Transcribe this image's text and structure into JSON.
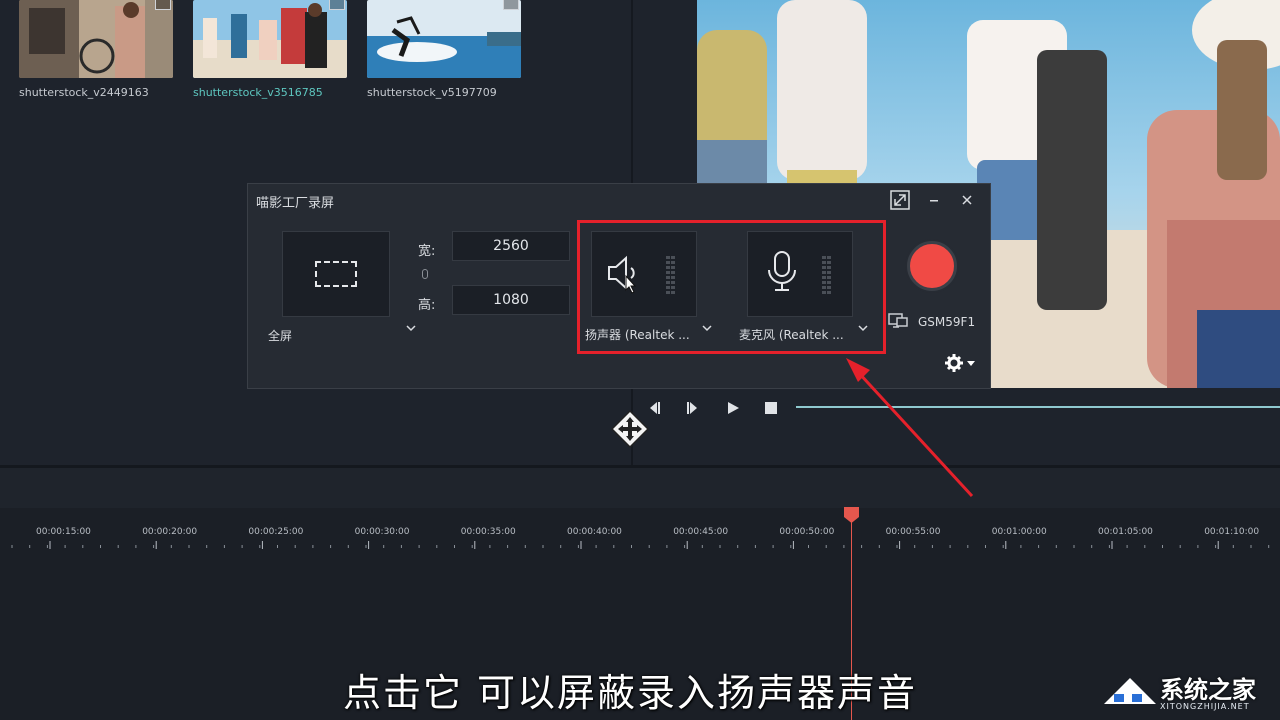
{
  "media": {
    "items": [
      {
        "name": "shutterstock_v2449163",
        "active": false
      },
      {
        "name": "shutterstock_v3516785",
        "active": true
      },
      {
        "name": "shutterstock_v5197709",
        "active": false
      }
    ]
  },
  "recorder": {
    "title": "喵影工厂录屏",
    "mode": "全屏",
    "width_label": "宽:",
    "width_value": "2560",
    "height_label": "高:",
    "height_value": "1080",
    "speaker_label": "扬声器 (Realtek ...",
    "mic_label": "麦克风 (Realtek ...",
    "screen_label": "GSM59F1"
  },
  "timeline": {
    "ticks": [
      "00:00:15:00",
      "00:00:20:00",
      "00:00:25:00",
      "00:00:30:00",
      "00:00:35:00",
      "00:00:40:00",
      "00:00:45:00",
      "00:00:50:00",
      "00:00:55:00",
      "00:01:00:00",
      "00:01:05:00",
      "00:01:10:00"
    ]
  },
  "subtitle": "点击它 可以屏蔽录入扬声器声音",
  "watermark": {
    "title": "系统之家",
    "url": "XITONGZHIJIA.NET"
  },
  "colors": {
    "accent": "#5ec7c0",
    "record": "#f04a45",
    "highlight": "#e5212b",
    "playhead": "#e5574d"
  }
}
